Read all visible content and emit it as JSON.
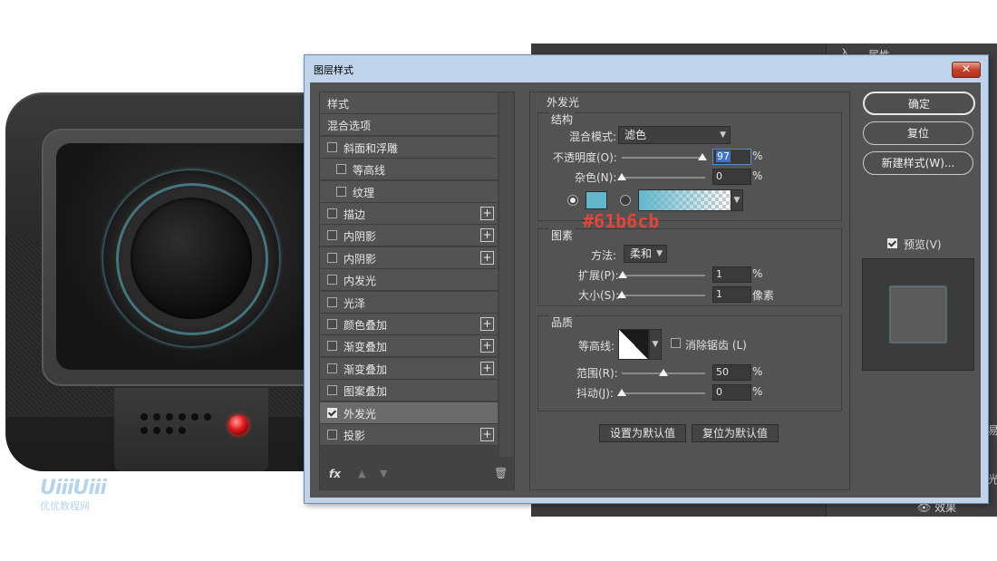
{
  "watermark": {
    "logo": "UiiiUiii",
    "site": "优优教程网"
  },
  "dialog": {
    "title": "图层样式",
    "close_label": "✕"
  },
  "styles_list": {
    "items": [
      {
        "label": "样式",
        "has_checkbox": false,
        "checked": false,
        "has_plus": false,
        "indent": 0,
        "active": false
      },
      {
        "label": "混合选项",
        "has_checkbox": false,
        "checked": false,
        "has_plus": false,
        "indent": 0,
        "active": false
      },
      {
        "label": "斜面和浮雕",
        "has_checkbox": true,
        "checked": false,
        "has_plus": false,
        "indent": 0,
        "active": false
      },
      {
        "label": "等高线",
        "has_checkbox": true,
        "checked": false,
        "has_plus": false,
        "indent": 1,
        "active": false
      },
      {
        "label": "纹理",
        "has_checkbox": true,
        "checked": false,
        "has_plus": false,
        "indent": 1,
        "active": false
      },
      {
        "label": "描边",
        "has_checkbox": true,
        "checked": false,
        "has_plus": true,
        "indent": 0,
        "active": false
      },
      {
        "label": "内阴影",
        "has_checkbox": true,
        "checked": false,
        "has_plus": true,
        "indent": 0,
        "active": false
      },
      {
        "label": "内阴影",
        "has_checkbox": true,
        "checked": false,
        "has_plus": true,
        "indent": 0,
        "active": false
      },
      {
        "label": "内发光",
        "has_checkbox": true,
        "checked": false,
        "has_plus": false,
        "indent": 0,
        "active": false
      },
      {
        "label": "光泽",
        "has_checkbox": true,
        "checked": false,
        "has_plus": false,
        "indent": 0,
        "active": false
      },
      {
        "label": "颜色叠加",
        "has_checkbox": true,
        "checked": false,
        "has_plus": true,
        "indent": 0,
        "active": false
      },
      {
        "label": "渐变叠加",
        "has_checkbox": true,
        "checked": false,
        "has_plus": true,
        "indent": 0,
        "active": false
      },
      {
        "label": "渐变叠加",
        "has_checkbox": true,
        "checked": false,
        "has_plus": true,
        "indent": 0,
        "active": false
      },
      {
        "label": "图案叠加",
        "has_checkbox": true,
        "checked": false,
        "has_plus": false,
        "indent": 0,
        "active": false
      },
      {
        "label": "外发光",
        "has_checkbox": true,
        "checked": true,
        "has_plus": false,
        "indent": 0,
        "active": true
      },
      {
        "label": "投影",
        "has_checkbox": true,
        "checked": false,
        "has_plus": true,
        "indent": 0,
        "active": false
      }
    ],
    "footer": {
      "fx_label": "fx",
      "up_icon": "▲",
      "down_icon": "▼",
      "trash_icon": "🗑"
    }
  },
  "outer_glow": {
    "title": "外发光",
    "structure": {
      "title": "结构",
      "blend_mode_label": "混合模式:",
      "blend_mode_value": "滤色",
      "opacity_label": "不透明度(O):",
      "opacity_value": "97",
      "opacity_fraction": 0.97,
      "noise_label": "杂色(N):",
      "noise_value": "0",
      "noise_fraction": 0,
      "percent": "%",
      "color": "#61b6cb",
      "color_mode": "solid"
    },
    "annotation": "#61b6cb",
    "elements": {
      "title": "图素",
      "technique_label": "方法:",
      "technique_value": "柔和",
      "spread_label": "扩展(P):",
      "spread_value": "1",
      "spread_fraction": 0.01,
      "size_label": "大小(S):",
      "size_value": "1",
      "size_fraction": 0.004,
      "size_unit": "像素",
      "percent": "%"
    },
    "quality": {
      "title": "品质",
      "contour_label": "等高线:",
      "antialias_label": "消除锯齿 (L)",
      "antialias_checked": false,
      "range_label": "范围(R):",
      "range_value": "50",
      "range_fraction": 0.5,
      "jitter_label": "抖动(J):",
      "jitter_value": "0",
      "jitter_fraction": 0,
      "percent": "%"
    },
    "set_default_label": "设置为默认值",
    "reset_default_label": "复位为默认值"
  },
  "actions": {
    "ok_label": "确定",
    "reset_label": "复位",
    "new_style_label": "新建样式(W)...",
    "preview_label": "预览(V)",
    "preview_checked": true
  },
  "background_panel": {
    "effects_label": "效果",
    "side_labels": [
      "入",
      "属性",
      "光",
      "易"
    ]
  }
}
